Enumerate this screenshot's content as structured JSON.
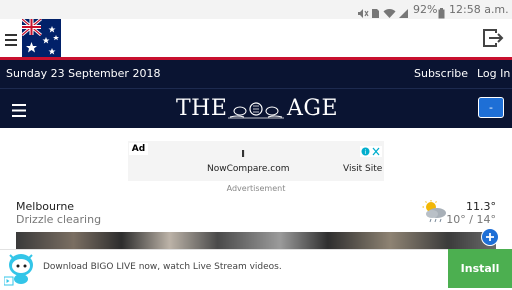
{
  "status_bar": {
    "battery": "92%",
    "time": "12:58 a.m."
  },
  "header": {
    "date": "Sunday 23 September 2018",
    "subscribe": "Subscribe",
    "login": "Log In",
    "logo_left": "THE",
    "logo_right": "AGE",
    "search_button": "-"
  },
  "ad": {
    "label": "Ad",
    "glyph": "ı",
    "url": "NowCompare.com",
    "cta": "Visit Site",
    "caption": "Advertisement"
  },
  "weather": {
    "city": "Melbourne",
    "condition": "Drizzle clearing",
    "current_temp": "11.3°",
    "range": "10° / 14°"
  },
  "bottom_ad": {
    "text": "Download BIGO LIVE now, watch Live Stream videos.",
    "install": "Install"
  },
  "colors": {
    "navy": "#0a1432",
    "red_rule": "#c8102e",
    "install_green": "#4caf50"
  }
}
